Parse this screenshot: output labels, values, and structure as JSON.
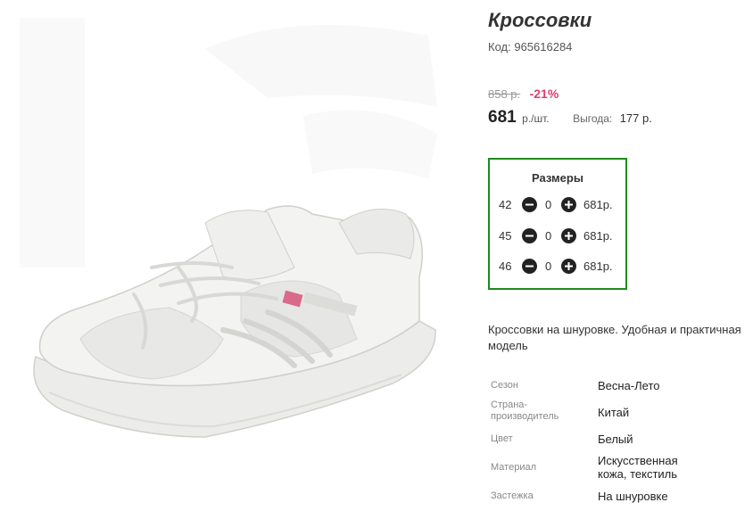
{
  "product": {
    "title": "Кроссовки",
    "code_label": "Код:",
    "code_value": "965616284",
    "old_price": "858 р.",
    "discount": "-21%",
    "price": "681",
    "price_unit": "р./шт.",
    "benefit_label": "Выгода:",
    "benefit_value": "177 р.",
    "image_icon": "sneaker-photo"
  },
  "sizes": {
    "title": "Размеры",
    "rows": [
      {
        "size": "42",
        "qty": "0",
        "price": "681р."
      },
      {
        "size": "45",
        "qty": "0",
        "price": "681р."
      },
      {
        "size": "46",
        "qty": "0",
        "price": "681р."
      }
    ],
    "minus_icon": "minus-circle-icon",
    "plus_icon": "plus-circle-icon",
    "border_color": "#1e8a1e"
  },
  "description": "Кроссовки на шнуровке. Удобная и практичная модель",
  "properties": [
    {
      "label": "Сезон",
      "value": "Весна-Лето"
    },
    {
      "label": "Страна-производитель",
      "label_line1": "Страна-",
      "label_line2": "производитель",
      "value": "Китай"
    },
    {
      "label": "Цвет",
      "value": "Белый"
    },
    {
      "label": "Материал",
      "value": "Искусственная кожа, текстиль",
      "value_line1": "Искусственная",
      "value_line2": "кожа, текстиль"
    },
    {
      "label": "Застежка",
      "value": "На шнуровке"
    }
  ],
  "colors": {
    "discount": "#e0416b",
    "accent_border": "#1e8a1e"
  }
}
